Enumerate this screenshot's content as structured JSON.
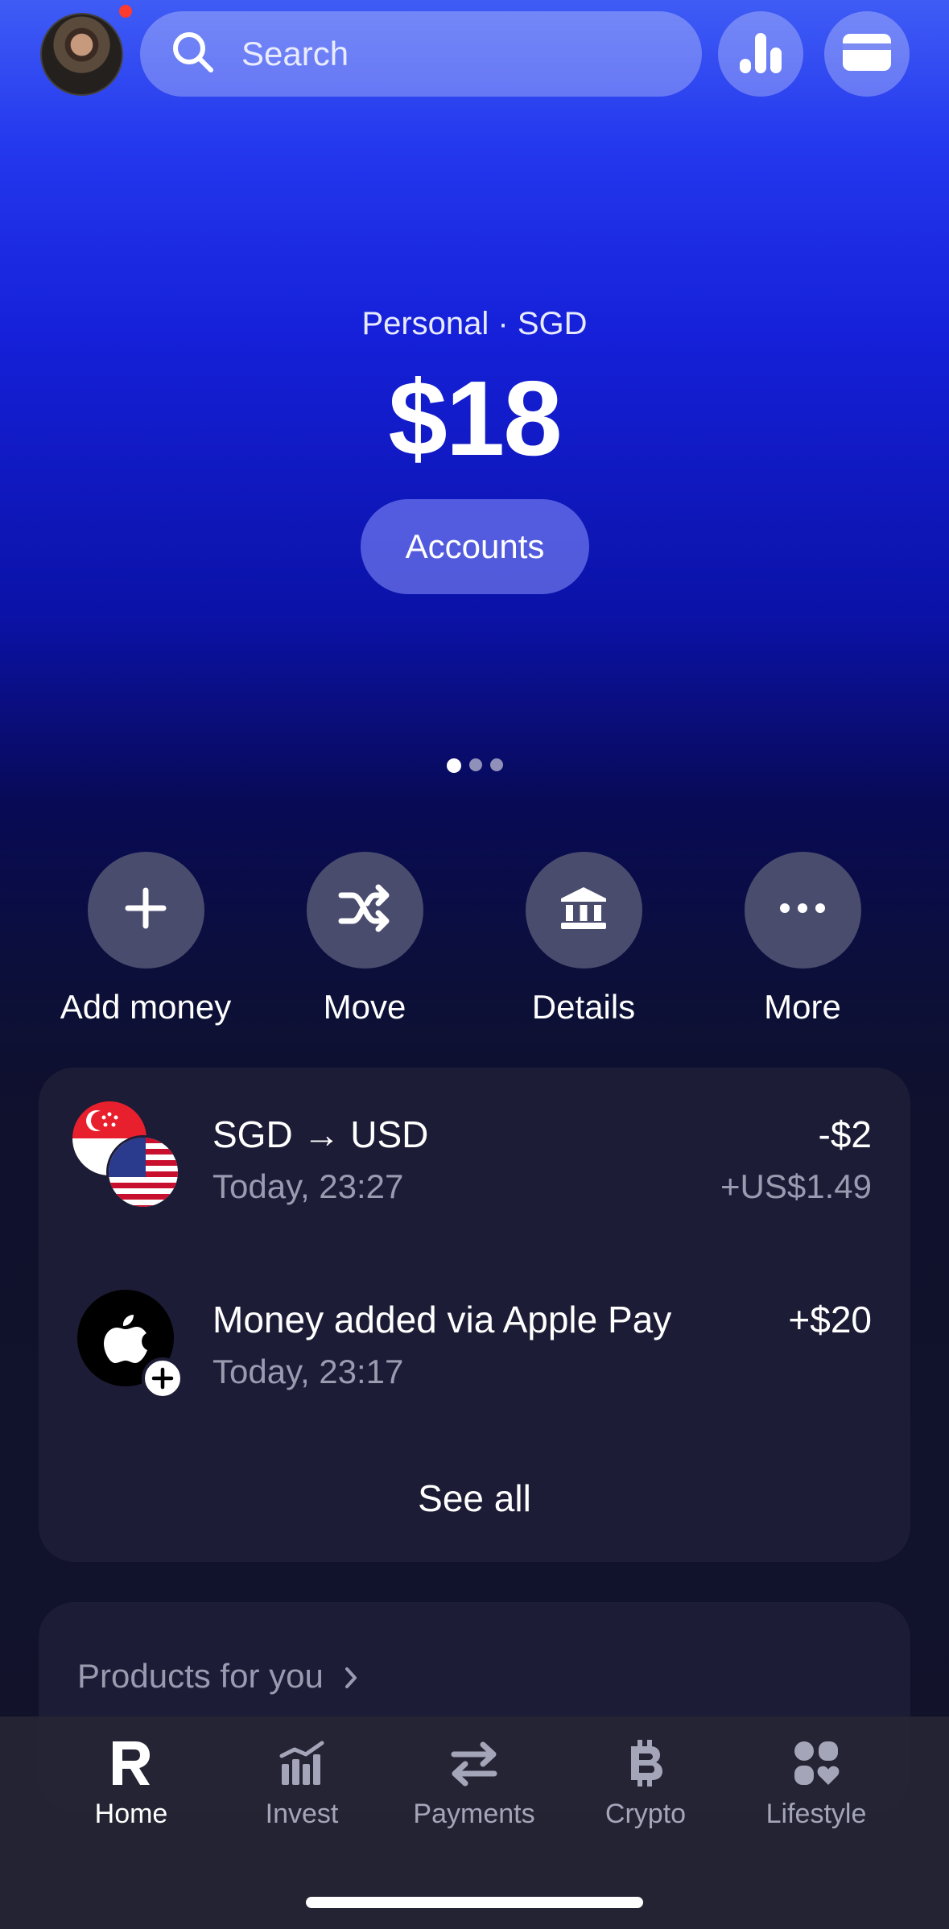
{
  "header": {
    "search_placeholder": "Search",
    "avatar_notification": true,
    "buttons": [
      "analytics-icon",
      "card-icon"
    ]
  },
  "balance": {
    "label": "Personal · SGD",
    "amount": "$18",
    "accounts_label": "Accounts",
    "page_dots": {
      "count": 3,
      "active": 1
    }
  },
  "actions": [
    {
      "label": "Add money",
      "icon": "plus-icon"
    },
    {
      "label": "Move",
      "icon": "shuffle-icon"
    },
    {
      "label": "Details",
      "icon": "bank-icon"
    },
    {
      "label": "More",
      "icon": "more-icon"
    }
  ],
  "transactions": [
    {
      "title": "SGD → USD",
      "time": "Today, 23:27",
      "amount": "-$2",
      "sub_amount": "+US$1.49",
      "icon": "sg-us-flags-icon"
    },
    {
      "title": "Money added via Apple Pay",
      "time": "Today, 23:17",
      "amount": "+$20",
      "icon": "apple-pay-icon"
    }
  ],
  "see_all_label": "See all",
  "products": {
    "label": "Products for you"
  },
  "bottom_nav": [
    {
      "label": "Home",
      "icon": "revolut-r-icon",
      "active": true
    },
    {
      "label": "Invest",
      "icon": "invest-icon",
      "active": false
    },
    {
      "label": "Payments",
      "icon": "transfer-arrows-icon",
      "active": false
    },
    {
      "label": "Crypto",
      "icon": "bitcoin-icon",
      "active": false
    },
    {
      "label": "Lifestyle",
      "icon": "lifestyle-icon",
      "active": false
    }
  ],
  "colors": {
    "background_top": "#3f5cf5",
    "background_bottom": "#12132a",
    "card": "#1c1c36",
    "action_circle": "#4a4c6e",
    "secondary_text": "#9a9bb0"
  }
}
